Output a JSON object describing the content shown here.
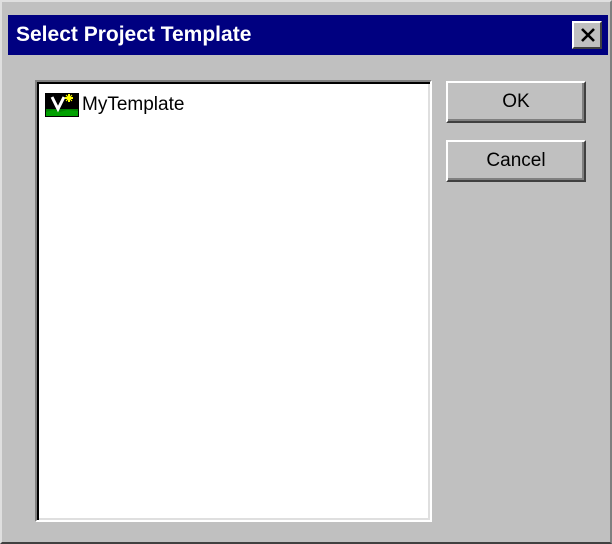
{
  "dialog": {
    "title": "Select Project Template",
    "close_icon": "close-icon"
  },
  "template_list": {
    "items": [
      {
        "label": "MyTemplate",
        "icon": "vision-template-icon"
      }
    ]
  },
  "buttons": {
    "ok_label": "OK",
    "cancel_label": "Cancel"
  },
  "colors": {
    "titlebar": "#000080",
    "dialog_face": "#c0c0c0",
    "list_background": "#ffffff"
  }
}
